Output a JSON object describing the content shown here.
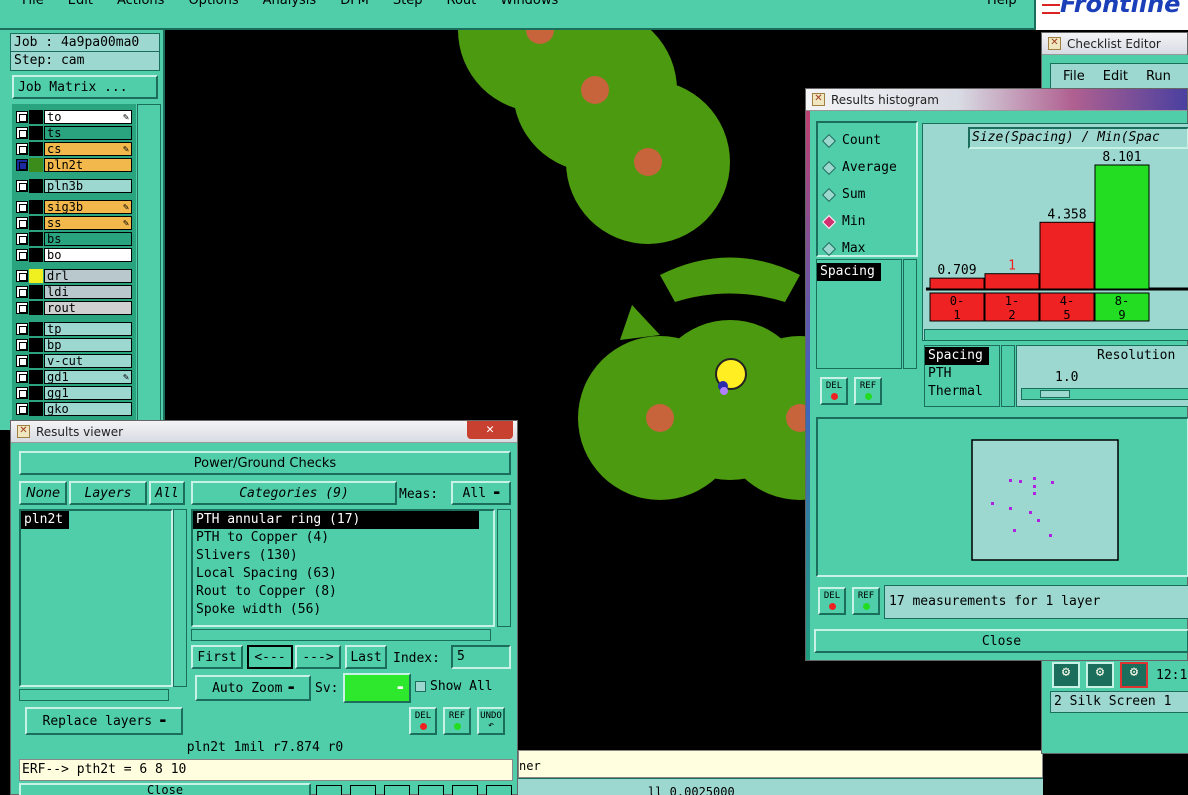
{
  "menubar": {
    "items": [
      "File",
      "Edit",
      "Actions",
      "Options",
      "Analysis",
      "DFM",
      "Step",
      "Rout",
      "Windows"
    ],
    "help": "Help",
    "brand": "Frontline"
  },
  "job": {
    "job_label": "Job : 4a9pa00ma0",
    "step_label": "Step: cam",
    "matrix_button": "Job Matrix ..."
  },
  "layers": [
    {
      "name": "to",
      "color": "#ffffff",
      "editable": true
    },
    {
      "name": "ts",
      "color": "#2aa37f",
      "editable": false
    },
    {
      "name": "cs",
      "color": "#f2b84b",
      "editable": true
    },
    {
      "name": "pln2t",
      "color": "#f2b84b",
      "editable": false
    },
    {
      "name": "pln3b",
      "color": "#9cd8d0",
      "editable": false
    },
    {
      "name": "sig3b",
      "color": "#f2b84b",
      "editable": true
    },
    {
      "name": "ss",
      "color": "#f2b84b",
      "editable": true
    },
    {
      "name": "bs",
      "color": "#2aa37f",
      "editable": false
    },
    {
      "name": "bo",
      "color": "#ffffff",
      "editable": false
    },
    {
      "name": "drl",
      "color": "#b9c8cc",
      "editable": false
    },
    {
      "name": "ldi",
      "color": "#b9c8cc",
      "editable": false
    },
    {
      "name": "rout",
      "color": "#d0d0d0",
      "editable": false
    },
    {
      "name": "tp",
      "color": "#9cd8d0",
      "editable": false
    },
    {
      "name": "bp",
      "color": "#9cd8d0",
      "editable": false
    },
    {
      "name": "v-cut",
      "color": "#9cd8d0",
      "editable": false
    },
    {
      "name": "gd1",
      "color": "#9cd8d0",
      "editable": true
    },
    {
      "name": "gg1",
      "color": "#9cd8d0",
      "editable": false
    },
    {
      "name": "gko",
      "color": "#9cd8d0",
      "editable": false
    }
  ],
  "results_viewer": {
    "title": "Results viewer",
    "close_x": "✕",
    "header": "Power/Ground Checks",
    "none_btn": "None",
    "layers_btn": "Layers",
    "all_btn": "All",
    "layer_list": [
      "pln2t"
    ],
    "categories_btn": "Categories (9)",
    "meas_label": "Meas:",
    "meas_value": "All",
    "categories": [
      "PTH annular ring (17)",
      "PTH to Copper (4)",
      "Slivers (130)",
      "Local Spacing (63)",
      "Rout to Copper (8)",
      "Spoke width (56)"
    ],
    "first_btn": "First",
    "prev_btn": "<---",
    "next_btn": "--->",
    "last_btn": "Last",
    "index_label": "Index:",
    "index_value": "5",
    "auto_zoom": "Auto Zoom",
    "sv_label": "Sv:",
    "show_all": "Show All",
    "replace_layers": "Replace layers",
    "del": "DEL",
    "ref": "REF",
    "undo": "UNDO",
    "status": "pln2t 1mil  r7.874  r0",
    "erf": "ERF--> pth2t = 6 8 10",
    "close": "Close"
  },
  "histogram": {
    "title": "Results histogram",
    "modes": [
      {
        "label": "Count",
        "on": false
      },
      {
        "label": "Average",
        "on": false
      },
      {
        "label": "Sum",
        "on": false
      },
      {
        "label": "Min",
        "on": true
      },
      {
        "label": "Max",
        "on": false
      }
    ],
    "measure_list": [
      "Spacing"
    ],
    "chart_title": "Size(Spacing) / Min(Spac",
    "secondary_list": [
      "Spacing",
      "PTH",
      "Thermal"
    ],
    "resolution_label": "Resolution",
    "resolution_value": "1.0",
    "del": "DEL",
    "ref": "REF",
    "summary": "17 measurements for 1 layer",
    "close": "Close"
  },
  "chart_data": {
    "type": "bar",
    "categories": [
      "0-1",
      "1-2",
      "4-5",
      "8-9"
    ],
    "values": [
      0.709,
      1,
      4.358,
      8.101
    ],
    "value_labels": [
      "0.709",
      "1",
      "4.358",
      "8.101"
    ],
    "bar_colors": [
      "#ee2222",
      "#ee2222",
      "#ee2222",
      "#22dd22"
    ],
    "label_colors": [
      "#000000",
      "#ee2222",
      "#000000",
      "#000000"
    ],
    "ylim": [
      0,
      8.101
    ],
    "title": "Size(Spacing) / Min(Spac"
  },
  "checklist": {
    "title": "Checklist Editor",
    "menu": [
      "File",
      "Edit",
      "Run"
    ],
    "time": "12:1",
    "row": "2 Silk Screen 1"
  },
  "bottom": {
    "partial_text": "ner",
    "footer_text": "ll     0.0025000"
  }
}
